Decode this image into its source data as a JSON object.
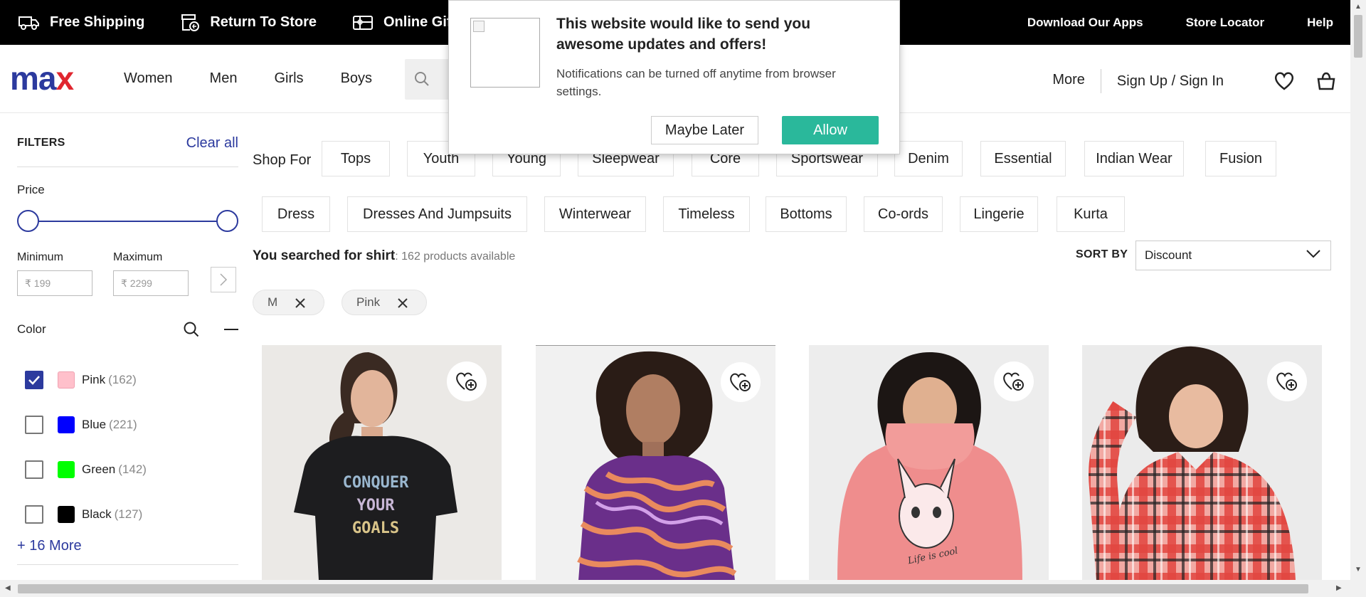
{
  "topbar": {
    "left": [
      {
        "icon": "truck-icon",
        "label": "Free Shipping"
      },
      {
        "icon": "store-return-icon",
        "label": "Return To Store"
      },
      {
        "icon": "gift-card-icon",
        "label": "Online Gift"
      }
    ],
    "right": [
      "Download Our Apps",
      "Store Locator",
      "Help"
    ]
  },
  "header": {
    "logo_a": "ma",
    "logo_b": "x",
    "nav": [
      "Women",
      "Men",
      "Girls",
      "Boys"
    ],
    "more": "More",
    "signin": "Sign Up / Sign In"
  },
  "sidebar": {
    "filters": "FILTERS",
    "clear_all": "Clear all",
    "price": "Price",
    "minimum": "Minimum",
    "maximum": "Maximum",
    "min_placeholder": "₹ 199",
    "max_placeholder": "₹ 2299",
    "color": "Color",
    "colors": [
      {
        "name": "Pink",
        "count": "(162)",
        "hex": "#ffc0cb",
        "checked": true
      },
      {
        "name": "Blue",
        "count": "(221)",
        "hex": "#0000ff",
        "checked": false
      },
      {
        "name": "Green",
        "count": "(142)",
        "hex": "#00ff00",
        "checked": false
      },
      {
        "name": "Black",
        "count": "(127)",
        "hex": "#000000",
        "checked": false
      }
    ],
    "more_link": "+ 16 More"
  },
  "main": {
    "shop_for": "Shop For",
    "chips_row1": [
      "Tops",
      "Youth",
      "Young",
      "Sleepwear",
      "Core",
      "Sportswear",
      "Denim",
      "Essential",
      "Indian Wear",
      "Fusion"
    ],
    "chips_row2": [
      "Dress",
      "Dresses And Jumpsuits",
      "Winterwear",
      "Timeless",
      "Bottoms",
      "Co-ords",
      "Lingerie",
      "Kurta"
    ],
    "search_label": "You searched for shirt",
    "search_count": ": 162 products available",
    "sort_by": "SORT BY",
    "sort_value": "Discount",
    "applied": [
      "M",
      "Pink"
    ]
  },
  "products": [
    {
      "alt": "black-tee",
      "print": [
        "CONQUER",
        "YOUR",
        "GOALS"
      ]
    },
    {
      "alt": "swirl-top"
    },
    {
      "alt": "pink-fleece",
      "print": [
        "Life is cool"
      ]
    },
    {
      "alt": "check-shirt"
    }
  ],
  "popup": {
    "title": "This website would like to send you awesome updates and offers!",
    "desc": "Notifications can be turned off anytime from browser settings.",
    "later": "Maybe Later",
    "allow": "Allow"
  },
  "colors": {
    "brand_blue": "#2c3a9e",
    "brand_red": "#e0262f",
    "allow_green": "#2ab89b"
  }
}
